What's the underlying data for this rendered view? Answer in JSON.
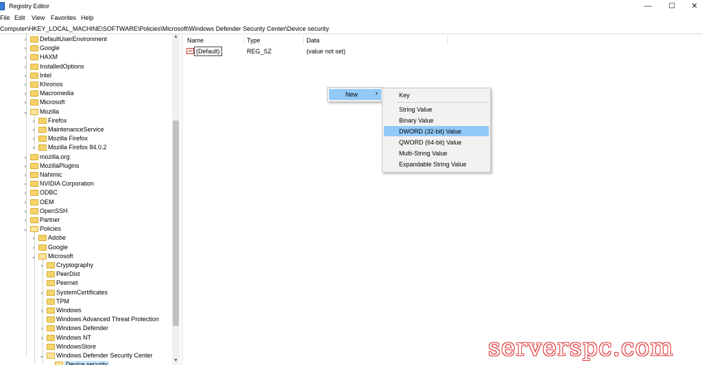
{
  "window": {
    "title": "Registry Editor",
    "minimize_glyph": "—",
    "maximize_glyph": "☐",
    "close_glyph": "✕"
  },
  "menubar": [
    "File",
    "Edit",
    "View",
    "Favorites",
    "Help"
  ],
  "address": "Computer\\HKEY_LOCAL_MACHINE\\SOFTWARE\\Policies\\Microsoft\\Windows Defender Security Center\\Device security",
  "tree": [
    {
      "label": "DefaultUserEnvironment",
      "level": 0,
      "state": "collapsed"
    },
    {
      "label": "Google",
      "level": 0,
      "state": "collapsed"
    },
    {
      "label": "HAXM",
      "level": 0,
      "state": "collapsed"
    },
    {
      "label": "InstalledOptions",
      "level": 0,
      "state": "collapsed"
    },
    {
      "label": "Intel",
      "level": 0,
      "state": "collapsed"
    },
    {
      "label": "Khronos",
      "level": 0,
      "state": "collapsed"
    },
    {
      "label": "Macromedia",
      "level": 0,
      "state": "collapsed"
    },
    {
      "label": "Microsoft",
      "level": 0,
      "state": "collapsed"
    },
    {
      "label": "Mozilla",
      "level": 0,
      "state": "expanded"
    },
    {
      "label": "Firefox",
      "level": 1,
      "state": "collapsed"
    },
    {
      "label": "MaintenanceService",
      "level": 1,
      "state": "collapsed"
    },
    {
      "label": "Mozilla Firefox",
      "level": 1,
      "state": "collapsed"
    },
    {
      "label": "Mozilla Firefox 84.0.2",
      "level": 1,
      "state": "collapsed"
    },
    {
      "label": "mozilla.org",
      "level": 0,
      "state": "collapsed"
    },
    {
      "label": "MozillaPlugins",
      "level": 0,
      "state": "collapsed"
    },
    {
      "label": "Nahimic",
      "level": 0,
      "state": "collapsed"
    },
    {
      "label": "NVIDIA Corporation",
      "level": 0,
      "state": "collapsed"
    },
    {
      "label": "ODBC",
      "level": 0,
      "state": "collapsed"
    },
    {
      "label": "OEM",
      "level": 0,
      "state": "collapsed"
    },
    {
      "label": "OpenSSH",
      "level": 0,
      "state": "collapsed"
    },
    {
      "label": "Partner",
      "level": 0,
      "state": "collapsed"
    },
    {
      "label": "Policies",
      "level": 0,
      "state": "expanded"
    },
    {
      "label": "Adobe",
      "level": 1,
      "state": "collapsed"
    },
    {
      "label": "Google",
      "level": 1,
      "state": "collapsed"
    },
    {
      "label": "Microsoft",
      "level": 1,
      "state": "expanded"
    },
    {
      "label": "Cryptography",
      "level": 2,
      "state": "collapsed"
    },
    {
      "label": "PeerDist",
      "level": 2,
      "state": "leaf"
    },
    {
      "label": "Peernet",
      "level": 2,
      "state": "leaf"
    },
    {
      "label": "SystemCertificates",
      "level": 2,
      "state": "collapsed"
    },
    {
      "label": "TPM",
      "level": 2,
      "state": "leaf"
    },
    {
      "label": "Windows",
      "level": 2,
      "state": "collapsed"
    },
    {
      "label": "Windows Advanced Threat Protection",
      "level": 2,
      "state": "leaf"
    },
    {
      "label": "Windows Defender",
      "level": 2,
      "state": "collapsed"
    },
    {
      "label": "Windows NT",
      "level": 2,
      "state": "collapsed"
    },
    {
      "label": "WindowsStore",
      "level": 2,
      "state": "leaf"
    },
    {
      "label": "Windows Defender Security Center",
      "level": 2,
      "state": "expanded"
    },
    {
      "label": "Device security",
      "level": 3,
      "state": "selected"
    }
  ],
  "list": {
    "columns": [
      "Name",
      "Type",
      "Data"
    ],
    "rows": [
      {
        "name": "(Default)",
        "type": "REG_SZ",
        "data": "(value not set)",
        "icon": "ab"
      }
    ]
  },
  "context_menu": {
    "new_label": "New",
    "new_arrow": "›",
    "items": [
      "Key",
      "String Value",
      "Binary Value",
      "DWORD (32-bit) Value",
      "QWORD (64-bit) Value",
      "Multi-String Value",
      "Expandable String Value"
    ],
    "highlighted": "DWORD (32-bit) Value"
  },
  "watermark": "serverspc.com"
}
